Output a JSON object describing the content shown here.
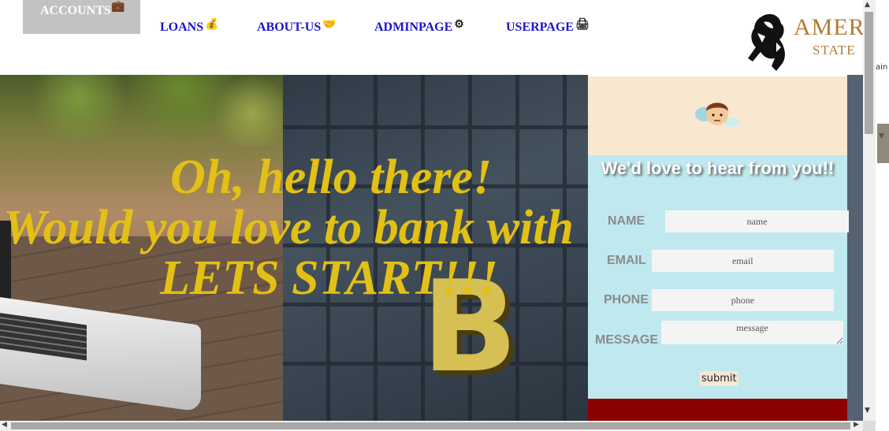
{
  "nav": {
    "items": [
      {
        "label": "ACCOUNTS",
        "icon": "briefcase-icon"
      },
      {
        "label": "LOANS",
        "icon": "money-bag-icon"
      },
      {
        "label": "ABOUT-US",
        "icon": "handshake-icon"
      },
      {
        "label": "ADMINPAGE",
        "icon": "gear-hands-icon"
      },
      {
        "label": "USERPAGE",
        "icon": "user-card-icon"
      }
    ],
    "logo_text_1": "AMER",
    "logo_text_2": "STATE"
  },
  "hero": {
    "line1": "Oh, hello there!",
    "line2": "Would you love to bank with us?",
    "line3": "LETS START!!!"
  },
  "contact_form": {
    "title": "We'd love to hear from you!!",
    "name_label": "NAME",
    "name_placeholder": "name",
    "email_label": "EMAIL",
    "email_placeholder": "email",
    "phone_label": "PHONE",
    "phone_placeholder": "phone",
    "message_label": "MESSAGE",
    "message_placeholder": "message",
    "submit_label": "submit"
  },
  "side_text": "ain",
  "colors": {
    "nav_link": "#1a14c8",
    "hero_text": "#e2c016",
    "form_bg": "#bfe9ef",
    "form_top": "#f7e8cf",
    "footer_bar": "#8b0000",
    "logo": "#b57a35"
  }
}
